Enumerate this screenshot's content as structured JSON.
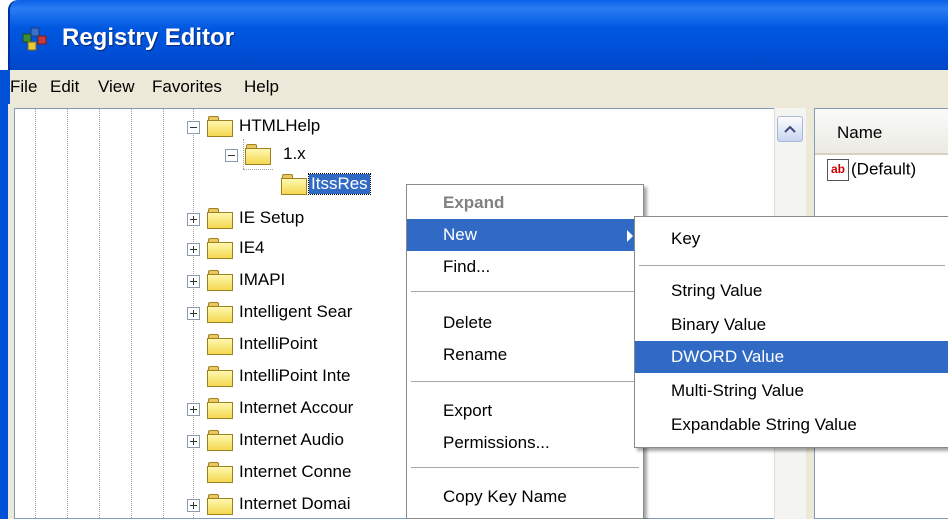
{
  "window": {
    "title": "Registry Editor"
  },
  "menubar": {
    "items": [
      "File",
      "Edit",
      "View",
      "Favorites",
      "Help"
    ]
  },
  "tree": {
    "nodes": [
      {
        "label": "HTMLHelp",
        "expander": "minus",
        "selected": false
      },
      {
        "label": "1.x",
        "expander": "minus",
        "selected": false
      },
      {
        "label": "ItssRes",
        "expander": "none",
        "selected": true
      },
      {
        "label": "IE Setup",
        "expander": "plus",
        "selected": false
      },
      {
        "label": "IE4",
        "expander": "plus",
        "selected": false
      },
      {
        "label": "IMAPI",
        "expander": "plus",
        "selected": false
      },
      {
        "label": "Intelligent Sear",
        "expander": "plus",
        "selected": false
      },
      {
        "label": "IntelliPoint",
        "expander": "none",
        "selected": false
      },
      {
        "label": "IntelliPoint Inte",
        "expander": "none",
        "selected": false
      },
      {
        "label": "Internet Accour",
        "expander": "plus",
        "selected": false
      },
      {
        "label": "Internet Audio",
        "expander": "plus",
        "selected": false
      },
      {
        "label": "Internet Conne",
        "expander": "none",
        "selected": false
      },
      {
        "label": "Internet Domai",
        "expander": "plus",
        "selected": false
      }
    ]
  },
  "listview": {
    "header_name": "Name",
    "rows": [
      {
        "icon": "string-value-icon",
        "icon_text": "ab",
        "name": "(Default)"
      }
    ]
  },
  "context_menu": {
    "items": {
      "expand": "Expand",
      "new": "New",
      "find": "Find...",
      "delete": "Delete",
      "rename": "Rename",
      "export": "Export",
      "permissions": "Permissions...",
      "copy_key_name": "Copy Key Name"
    }
  },
  "submenu": {
    "items": {
      "key": "Key",
      "string_value": "String Value",
      "binary_value": "Binary Value",
      "dword_value": "DWORD Value",
      "multi_string_value": "Multi-String Value",
      "expandable_string_value": "Expandable String Value"
    },
    "highlighted": "DWORD Value"
  },
  "colors": {
    "title_bar": "#0050d8",
    "highlight": "#316ac5",
    "menu_bg": "#ece9d8"
  }
}
